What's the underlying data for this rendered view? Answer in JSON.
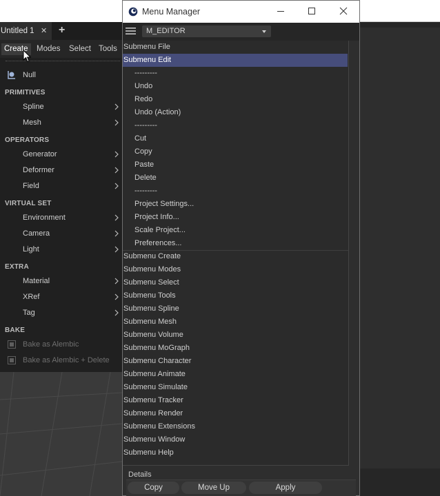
{
  "tab": {
    "title": "Untitled 1",
    "close": "✕",
    "add": "+"
  },
  "menubar": [
    "Create",
    "Modes",
    "Select",
    "Tools"
  ],
  "create_menu": {
    "null_label": "Null",
    "primitives_header": "PRIMITIVES",
    "spline": "Spline",
    "mesh": "Mesh",
    "operators_header": "OPERATORS",
    "generator": "Generator",
    "deformer": "Deformer",
    "field": "Field",
    "virtual_set_header": "VIRTUAL SET",
    "environment": "Environment",
    "camera": "Camera",
    "light": "Light",
    "extra_header": "EXTRA",
    "material": "Material",
    "xref": "XRef",
    "tag": "Tag",
    "bake_header": "BAKE",
    "bake_alembic": "Bake as Alembic",
    "bake_alembic_delete": "Bake as Alembic + Delete"
  },
  "menu_manager": {
    "title": "Menu Manager",
    "menu_select": "M_EDITOR",
    "submenu_file": "Submenu File",
    "submenu_edit": "Submenu Edit",
    "edit_items": [
      "---------",
      "Undo",
      "Redo",
      "Undo (Action)",
      "---------",
      "Cut",
      "Copy",
      "Paste",
      "Delete",
      "---------",
      "Project Settings...",
      "Project Info...",
      "Scale Project...",
      "Preferences..."
    ],
    "submenus": [
      "Submenu Create",
      "Submenu Modes",
      "Submenu Select",
      "Submenu Tools",
      "Submenu Spline",
      "Submenu Mesh",
      "Submenu Volume",
      "Submenu MoGraph",
      "Submenu Character",
      "Submenu Animate",
      "Submenu Simulate",
      "Submenu Tracker",
      "Submenu Render",
      "Submenu Extensions",
      "Submenu Window",
      "Submenu Help"
    ],
    "details_label": "Details",
    "buttons": {
      "copy": "Copy",
      "move_up": "Move Up",
      "apply": "Apply"
    }
  },
  "colors": {
    "selected_row": "#464d7b",
    "dropdown_bg": "#202020",
    "panel_bg": "#2b2b2b"
  }
}
